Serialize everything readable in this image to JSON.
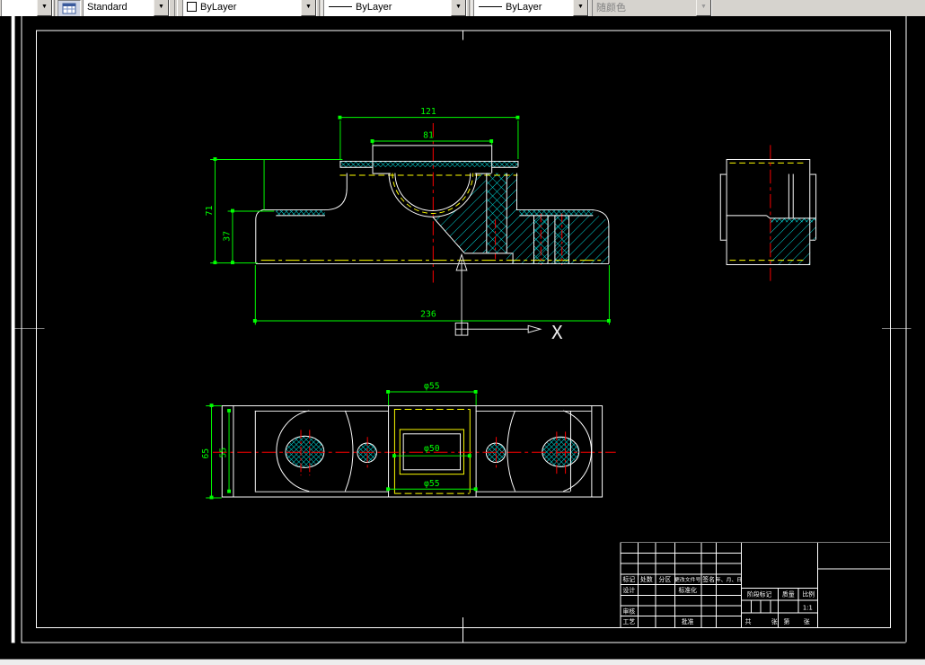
{
  "toolbar": {
    "style_value": "Standard",
    "color_value": "ByLayer",
    "linetype_value": "ByLayer",
    "lineweight_value": "ByLayer",
    "plotstyle_value": "随颜色"
  },
  "icons": {
    "dropdown_arrow": "▼"
  },
  "colors": {
    "dimension": "#00ff00",
    "centerline": "#ff0000",
    "hidden_line": "#ffff00",
    "hatch": "#00e0e0",
    "object_line": "#ffffff",
    "toolbar_bg": "#d6d3ce",
    "canvas_bg": "#000000"
  },
  "front_view": {
    "d121": "121",
    "d81": "81",
    "d71": "71",
    "d37": "37",
    "d236": "236"
  },
  "plan_view": {
    "d65": "65",
    "d55": "55",
    "dia_top": "φ55",
    "dia_mid": "φ50",
    "dia_bot": "φ55"
  },
  "ucs": {
    "x_label": "X"
  },
  "title_block": {
    "revision_headers": [
      "标记",
      "处数",
      "分区",
      "更改文件号",
      "签名",
      "年、月、日"
    ],
    "design": "设计",
    "standardization": "标准化",
    "check": "审核",
    "process": "工艺",
    "approve": "批准",
    "stage_mark": "阶段标记",
    "weight": "质量",
    "scale_label": "比例",
    "scale_value": "1:1",
    "sheet_total": "共",
    "sheet_unit1": "张",
    "sheet_page": "第",
    "sheet_unit2": "张"
  }
}
